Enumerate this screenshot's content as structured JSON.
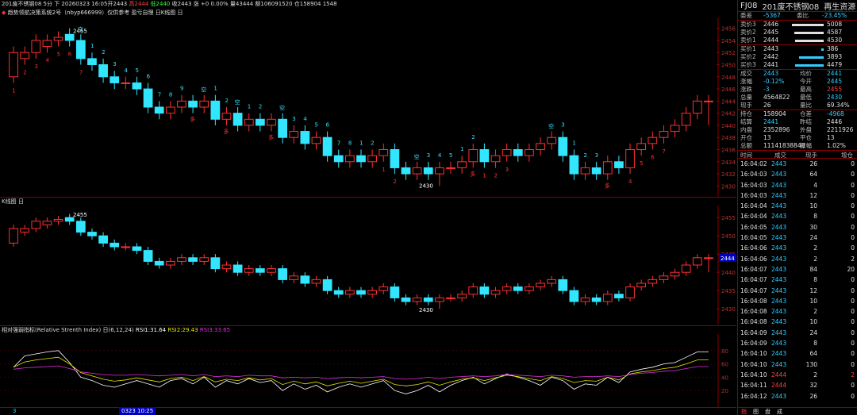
{
  "topbar": {
    "title": "201废不锈钢08 5分 下",
    "time": "20260323 16:05开2443",
    "high": "高2444",
    "low": "低2440",
    "close": "收2443",
    "change": "涨 +0 0.00%",
    "volume": "量43444",
    "amount": "额106091520",
    "oi": "仓158904 1548"
  },
  "strategy_label": "趋势领航决策系统2号（nbyp666999）仅供参考 盈亏自理 日K线图 日",
  "k_panel_title": "K线图 日",
  "rsi_title": {
    "name": "相对强弱指标(Relative Strenth Index) 日(6,12,24)",
    "rsi1": "RSI1:31.64",
    "rsi2": "RSI2:29.43",
    "rsi3": "RSI3:33.65"
  },
  "bottom": {
    "date_chip": "0323 10:25",
    "left_tick": "3"
  },
  "colors": {
    "up": "#ff3030",
    "down": "#33e6ff",
    "rsi1": "#ffffff",
    "rsi2": "#e6e600",
    "rsi3": "#e030e0",
    "border": "#8b0000"
  },
  "chart_data": {
    "type": "candlestick",
    "title": "201废不锈钢08 5分",
    "ylim_main": [
      2429,
      2457
    ],
    "ylim_k": [
      2427,
      2457
    ],
    "y_ticks_main": [
      "2456",
      "2454",
      "2452",
      "2450",
      "2448",
      "2446",
      "2444",
      "2442",
      "2440",
      "2438",
      "2436",
      "2434",
      "2432",
      "2430"
    ],
    "y_ticks_k": [
      "2455",
      "2450",
      "2445",
      "2440",
      "2435",
      "2430"
    ],
    "rsi_ticks": [
      "80",
      "60",
      "40",
      "20"
    ],
    "last_price_tag": "2444",
    "high_label": "2455",
    "low_label": "2430",
    "candles": [
      [
        2448,
        2452,
        2447,
        2453
      ],
      [
        2451,
        2452,
        2450,
        2453
      ],
      [
        2452,
        2454,
        2451,
        2455
      ],
      [
        2453,
        2454,
        2452,
        2455
      ],
      [
        2454,
        2454.5,
        2453,
        2455.5
      ],
      [
        2455,
        2454,
        2453,
        2456
      ],
      [
        2454,
        2451,
        2450,
        2455
      ],
      [
        2451,
        2450,
        2449,
        2452
      ],
      [
        2450,
        2448,
        2447,
        2451
      ],
      [
        2448,
        2447,
        2446,
        2449
      ],
      [
        2447,
        2447,
        2446,
        2448
      ],
      [
        2447,
        2446,
        2445,
        2448
      ],
      [
        2446,
        2443,
        2442,
        2447
      ],
      [
        2443,
        2442,
        2441,
        2444
      ],
      [
        2442,
        2443,
        2441,
        2444
      ],
      [
        2443,
        2444,
        2442,
        2445
      ],
      [
        2444,
        2443,
        2442,
        2445
      ],
      [
        2443,
        2444,
        2442,
        2445
      ],
      [
        2444,
        2441,
        2440,
        2445
      ],
      [
        2441,
        2442,
        2440,
        2443
      ],
      [
        2442,
        2440,
        2439,
        2443
      ],
      [
        2440,
        2441,
        2439,
        2442
      ],
      [
        2441,
        2440,
        2439,
        2442
      ],
      [
        2440,
        2441,
        2439,
        2442
      ],
      [
        2441,
        2438,
        2437,
        2442
      ],
      [
        2438,
        2439,
        2437,
        2440
      ],
      [
        2439,
        2437,
        2436,
        2440
      ],
      [
        2437,
        2438,
        2436,
        2439
      ],
      [
        2438,
        2435,
        2434,
        2439
      ],
      [
        2435,
        2434,
        2433,
        2436
      ],
      [
        2434,
        2435,
        2433,
        2436
      ],
      [
        2435,
        2434,
        2433,
        2436
      ],
      [
        2434,
        2435,
        2433,
        2436
      ],
      [
        2435,
        2436,
        2434,
        2437
      ],
      [
        2436,
        2433,
        2432,
        2437
      ],
      [
        2433,
        2432,
        2431,
        2434
      ],
      [
        2432,
        2433,
        2431,
        2434
      ],
      [
        2433,
        2432,
        2431,
        2434
      ],
      [
        2432,
        2433,
        2430,
        2434
      ],
      [
        2433,
        2433,
        2432,
        2434
      ],
      [
        2433,
        2434,
        2432,
        2435
      ],
      [
        2434,
        2436,
        2433,
        2437
      ],
      [
        2436,
        2434,
        2433,
        2437
      ],
      [
        2434,
        2435,
        2433,
        2436
      ],
      [
        2435,
        2436,
        2434,
        2437
      ],
      [
        2436,
        2435,
        2434,
        2437
      ],
      [
        2435,
        2436,
        2434,
        2437
      ],
      [
        2436,
        2437,
        2435,
        2438
      ],
      [
        2437,
        2438,
        2436,
        2439
      ],
      [
        2438,
        2435,
        2434,
        2439
      ],
      [
        2435,
        2432,
        2431,
        2436
      ],
      [
        2432,
        2433,
        2431,
        2434
      ],
      [
        2433,
        2432,
        2431,
        2434
      ],
      [
        2432,
        2434,
        2431,
        2435
      ],
      [
        2434,
        2433,
        2432,
        2435
      ],
      [
        2433,
        2436,
        2432,
        2437
      ],
      [
        2436,
        2437,
        2435,
        2438
      ],
      [
        2437,
        2438,
        2436,
        2439
      ],
      [
        2438,
        2439,
        2437,
        2440
      ],
      [
        2439,
        2440,
        2438,
        2441
      ],
      [
        2440,
        2442,
        2439,
        2443
      ],
      [
        2442,
        2444,
        2441,
        2445
      ],
      [
        2444,
        2444,
        2440,
        2445
      ]
    ],
    "rsi1": [
      55,
      72,
      75,
      78,
      80,
      62,
      40,
      35,
      28,
      25,
      30,
      35,
      30,
      25,
      35,
      38,
      30,
      40,
      25,
      35,
      30,
      38,
      32,
      35,
      20,
      30,
      22,
      28,
      18,
      25,
      30,
      25,
      30,
      35,
      20,
      15,
      20,
      28,
      18,
      28,
      35,
      40,
      30,
      38,
      45,
      40,
      35,
      28,
      40,
      35,
      22,
      30,
      28,
      40,
      32,
      48,
      52,
      55,
      60,
      62,
      70,
      78,
      78
    ],
    "rsi2": [
      55,
      63,
      66,
      68,
      70,
      60,
      47,
      42,
      37,
      34,
      36,
      39,
      36,
      33,
      38,
      40,
      35,
      41,
      33,
      37,
      35,
      39,
      36,
      38,
      29,
      34,
      30,
      33,
      27,
      31,
      34,
      31,
      34,
      37,
      29,
      27,
      29,
      33,
      28,
      33,
      37,
      39,
      35,
      39,
      43,
      41,
      38,
      35,
      41,
      38,
      32,
      35,
      34,
      40,
      36,
      45,
      48,
      50,
      53,
      55,
      60,
      66,
      66
    ],
    "rsi3": [
      52,
      54,
      55,
      56,
      57,
      53,
      48,
      46,
      44,
      43,
      43,
      44,
      43,
      42,
      43,
      44,
      42,
      44,
      41,
      42,
      41,
      43,
      42,
      42,
      39,
      40,
      39,
      40,
      38,
      39,
      40,
      39,
      40,
      41,
      38,
      37,
      38,
      40,
      38,
      40,
      41,
      42,
      41,
      42,
      44,
      43,
      42,
      41,
      43,
      42,
      40,
      41,
      41,
      42,
      41,
      44,
      46,
      47,
      49,
      50,
      53,
      56,
      56
    ]
  },
  "signals": {
    "kong": [
      "空",
      "空",
      "空",
      "空",
      "空",
      "空"
    ],
    "duo": [
      "多",
      "多",
      "多",
      "多",
      "多"
    ],
    "counts_cyan": [
      "1",
      "2",
      "3",
      "4",
      "5",
      "6",
      "7",
      "8",
      "9",
      "1",
      "2",
      "1",
      "2",
      "3",
      "4",
      "5",
      "6",
      "7",
      "8",
      "1",
      "2",
      "3",
      "4",
      "5",
      "1",
      "2",
      "3",
      "1",
      "2",
      "3"
    ],
    "counts_red": [
      "1",
      "2",
      "3",
      "4",
      "5",
      "6",
      "7",
      "1",
      "2",
      "1",
      "2",
      "3",
      "4",
      "5",
      "6",
      "7"
    ]
  },
  "quote": {
    "header_code": "FJ08",
    "header_name": "201废不锈钢08",
    "header_tag": "再生资源",
    "weicha_label": "委差",
    "weicha": "-5367",
    "weibi_label": "委比",
    "weibi": "-23.45%",
    "asks": [
      {
        "label": "卖价3",
        "price": "2446",
        "vol": "5008"
      },
      {
        "label": "卖价2",
        "price": "2445",
        "vol": "4587"
      },
      {
        "label": "卖价1",
        "price": "2444",
        "vol": "4530"
      }
    ],
    "bids": [
      {
        "label": "买价1",
        "price": "2443",
        "vol": "386"
      },
      {
        "label": "买价2",
        "price": "2442",
        "vol": "3893"
      },
      {
        "label": "买价3",
        "price": "2441",
        "vol": "4479"
      }
    ],
    "stats": [
      {
        "l1": "成交",
        "v1": "2443",
        "c1": "cyan",
        "l2": "均价",
        "v2": "2441",
        "c2": "cyan"
      },
      {
        "l1": "涨幅",
        "v1": "-0.12%",
        "c1": "cyan",
        "l2": "今开",
        "v2": "2445",
        "c2": "cyan"
      },
      {
        "l1": "涨跌",
        "v1": "-3",
        "c1": "cyan",
        "l2": "最高",
        "v2": "2455",
        "c2": "red"
      },
      {
        "l1": "总量",
        "v1": "4564822",
        "c1": "white",
        "l2": "最低",
        "v2": "2430",
        "c2": "cyan"
      },
      {
        "l1": "现手",
        "v1": "26",
        "c1": "white",
        "l2": "量比",
        "v2": "69.34%",
        "c2": "white"
      }
    ],
    "stats2": [
      {
        "l1": "持仓",
        "v1": "158904",
        "c1": "white",
        "l2": "仓差",
        "v2": "-4968",
        "c2": "cyan"
      },
      {
        "l1": "结算",
        "v1": "2441",
        "c1": "cyan",
        "l2": "昨结",
        "v2": "2446",
        "c2": "white"
      },
      {
        "l1": "内盘",
        "v1": "2352896",
        "c1": "white",
        "l2": "外盘",
        "v2": "2211926",
        "c2": "white"
      },
      {
        "l1": "开仓",
        "v1": "13",
        "c1": "white",
        "l2": "平仓",
        "v2": "13",
        "c2": "white"
      },
      {
        "l1": "总额",
        "v1": "11141838848",
        "c1": "white",
        "l2": "振幅",
        "v2": "1.02%",
        "c2": "white"
      }
    ]
  },
  "ticks": {
    "headers": [
      "时间",
      "成交",
      "现手",
      "增仓"
    ],
    "rows": [
      {
        "t": "16:04:02",
        "p": "2443",
        "v": "26",
        "z": "0",
        "pc": "cyan",
        "zc": "white"
      },
      {
        "t": "16:04:03",
        "p": "2443",
        "v": "64",
        "z": "0",
        "pc": "cyan",
        "zc": "white"
      },
      {
        "t": "16:04:03",
        "p": "2443",
        "v": "4",
        "z": "0",
        "pc": "cyan",
        "zc": "white"
      },
      {
        "t": "16:04:03",
        "p": "2443",
        "v": "12",
        "z": "0",
        "pc": "cyan",
        "zc": "white"
      },
      {
        "t": "16:04:04",
        "p": "2443",
        "v": "10",
        "z": "0",
        "pc": "cyan",
        "zc": "white"
      },
      {
        "t": "16:04:04",
        "p": "2443",
        "v": "8",
        "z": "0",
        "pc": "cyan",
        "zc": "white"
      },
      {
        "t": "16:04:05",
        "p": "2443",
        "v": "30",
        "z": "0",
        "pc": "cyan",
        "zc": "white"
      },
      {
        "t": "16:04:05",
        "p": "2443",
        "v": "24",
        "z": "0",
        "pc": "cyan",
        "zc": "white"
      },
      {
        "t": "16:04:06",
        "p": "2443",
        "v": "2",
        "z": "0",
        "pc": "cyan",
        "zc": "white"
      },
      {
        "t": "16:04:06",
        "p": "2443",
        "v": "2",
        "z": "2",
        "pc": "cyan",
        "zc": "white"
      },
      {
        "t": "16:04:07",
        "p": "2443",
        "v": "84",
        "z": "20",
        "pc": "cyan",
        "zc": "white"
      },
      {
        "t": "16:04:07",
        "p": "2443",
        "v": "8",
        "z": "0",
        "pc": "cyan",
        "zc": "white"
      },
      {
        "t": "16:04:07",
        "p": "2443",
        "v": "12",
        "z": "0",
        "pc": "cyan",
        "zc": "white"
      },
      {
        "t": "16:04:08",
        "p": "2443",
        "v": "10",
        "z": "0",
        "pc": "cyan",
        "zc": "white"
      },
      {
        "t": "16:04:08",
        "p": "2443",
        "v": "2",
        "z": "0",
        "pc": "cyan",
        "zc": "white"
      },
      {
        "t": "16:04:08",
        "p": "2443",
        "v": "10",
        "z": "0",
        "pc": "cyan",
        "zc": "white"
      },
      {
        "t": "16:04:09",
        "p": "2443",
        "v": "24",
        "z": "0",
        "pc": "cyan",
        "zc": "white"
      },
      {
        "t": "16:04:09",
        "p": "2443",
        "v": "8",
        "z": "0",
        "pc": "cyan",
        "zc": "white"
      },
      {
        "t": "16:04:10",
        "p": "2443",
        "v": "64",
        "z": "0",
        "pc": "cyan",
        "zc": "white"
      },
      {
        "t": "16:04:10",
        "p": "2443",
        "v": "130",
        "z": "0",
        "pc": "cyan",
        "zc": "white"
      },
      {
        "t": "16:04:10",
        "p": "2444",
        "v": "2",
        "z": "2",
        "pc": "red",
        "zc": "red"
      },
      {
        "t": "16:04:11",
        "p": "2444",
        "v": "32",
        "z": "0",
        "pc": "red",
        "zc": "white"
      },
      {
        "t": "16:04:12",
        "p": "2443",
        "v": "26",
        "z": "0",
        "pc": "cyan",
        "zc": "white"
      }
    ]
  },
  "footer_tabs": [
    "指",
    "图",
    "盘",
    "成"
  ]
}
